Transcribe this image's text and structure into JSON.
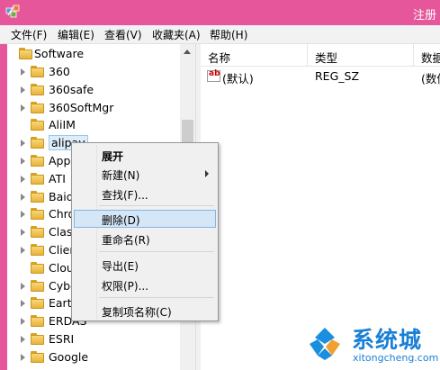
{
  "window": {
    "title": "注册"
  },
  "menu": [
    "文件(F)",
    "编辑(E)",
    "查看(V)",
    "收藏夹(A)",
    "帮助(H)"
  ],
  "tree": {
    "root": "Software",
    "items": [
      {
        "label": "360",
        "expander": true
      },
      {
        "label": "360safe",
        "expander": true
      },
      {
        "label": "360SoftMgr",
        "expander": true
      },
      {
        "label": "AliIM",
        "expander": false
      },
      {
        "label": "alipay",
        "expander": true,
        "selected": true
      },
      {
        "label": "App",
        "expander": true
      },
      {
        "label": "ATI",
        "expander": true
      },
      {
        "label": "Baid",
        "expander": true
      },
      {
        "label": "Chro",
        "expander": true
      },
      {
        "label": "Clas",
        "expander": true
      },
      {
        "label": "Clien",
        "expander": true
      },
      {
        "label": "Clou",
        "expander": false
      },
      {
        "label": "Cybe",
        "expander": true
      },
      {
        "label": "Earth",
        "expander": true
      },
      {
        "label": "ERDAS",
        "expander": true
      },
      {
        "label": "ESRI",
        "expander": true
      },
      {
        "label": "Google",
        "expander": true
      }
    ]
  },
  "values": {
    "columns": [
      "名称",
      "类型",
      "数据"
    ],
    "rows": [
      {
        "icon": "ab",
        "name": "(默认)",
        "type": "REG_SZ",
        "data": "(数值"
      }
    ]
  },
  "context_menu": {
    "items": [
      {
        "label": "展开",
        "bold": true
      },
      {
        "label": "新建(N)",
        "submenu": true
      },
      {
        "label": "查找(F)..."
      },
      {
        "label": "删除(D)",
        "highlighted": true
      },
      {
        "label": "重命名(R)"
      },
      {
        "label": "导出(E)"
      },
      {
        "label": "权限(P)..."
      },
      {
        "label": "复制项名称(C)"
      }
    ]
  },
  "watermark": {
    "brand": "系统城",
    "url": "xitongcheng.com"
  },
  "colors": {
    "titlebar": "#e5579a",
    "selection": "#ddeefa",
    "menu_highlight": "#d5e6f7",
    "watermark": "#1a7fd6"
  }
}
